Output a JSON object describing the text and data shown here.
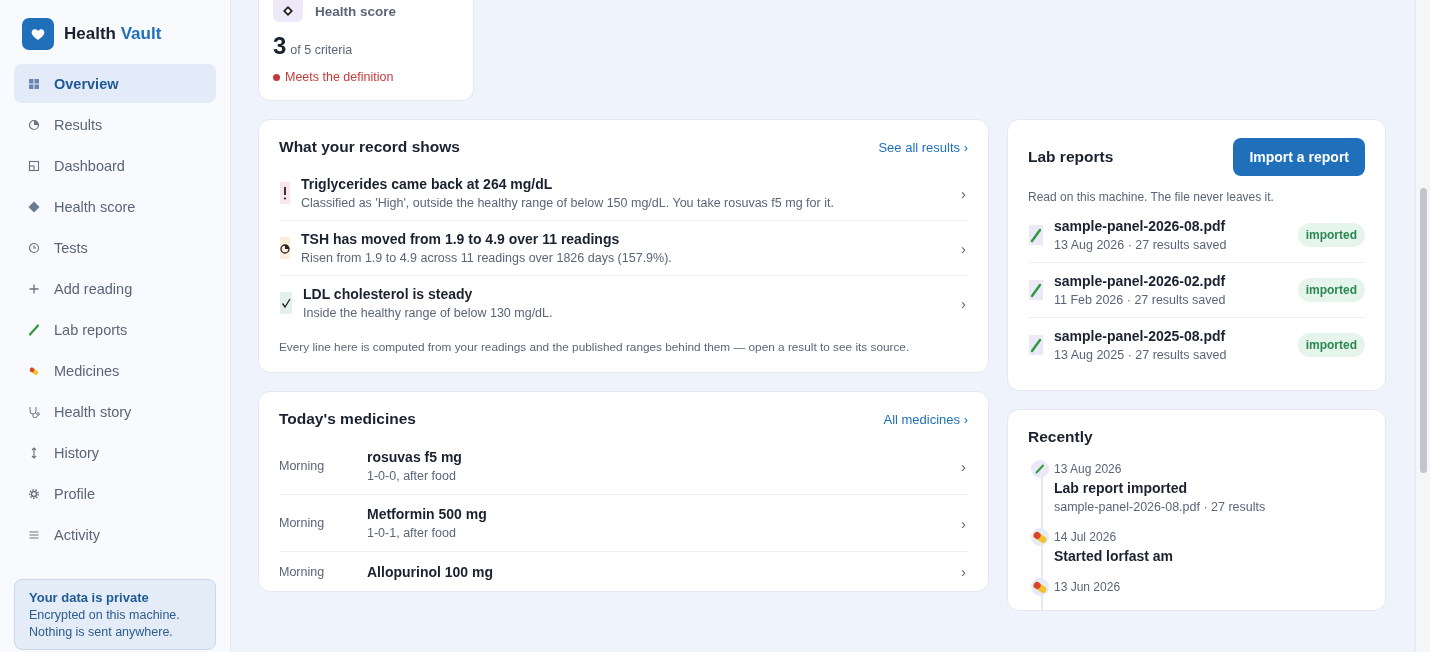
{
  "brand": {
    "name": "Health",
    "accent": "Vault"
  },
  "nav": [
    {
      "label": "Overview",
      "selected": true
    },
    {
      "label": "Results",
      "selected": false
    },
    {
      "label": "Dashboard",
      "selected": false
    },
    {
      "label": "Health score",
      "selected": false
    },
    {
      "label": "Tests",
      "selected": false
    },
    {
      "label": "Add reading",
      "selected": false
    },
    {
      "label": "Lab reports",
      "selected": false
    },
    {
      "label": "Medicines",
      "selected": false
    },
    {
      "label": "Health story",
      "selected": false
    },
    {
      "label": "History",
      "selected": false
    },
    {
      "label": "Profile",
      "selected": false
    },
    {
      "label": "Activity",
      "selected": false
    }
  ],
  "privacy": {
    "title": "Your data is private",
    "lines": [
      "Encrypted on this machine.",
      "Nothing is sent anywhere."
    ]
  },
  "score_card": {
    "title": "Health score",
    "value": "3",
    "of": "of 5 criteria",
    "status": "Meets the definition"
  },
  "record": {
    "title": "What your record shows",
    "link": "See all results ›",
    "items": [
      {
        "kind": "alert",
        "title": "Triglycerides came back at 264 mg/dL",
        "detail": "Classified as 'High', outside the healthy range of below 150 mg/dL. You take rosuvas f5 mg for it.",
        "chevron": "›"
      },
      {
        "kind": "trend",
        "title": "TSH has moved from 1.9 to 4.9 over 11 readings",
        "detail": "Risen from 1.9 to 4.9 across 11 readings over 1826 days (157.9%).",
        "chevron": "›"
      },
      {
        "kind": "ok",
        "title": "LDL cholesterol is steady",
        "detail": "Inside the healthy range of below 130 mg/dL.",
        "chevron": "›"
      }
    ],
    "footnote": "Every line here is computed from your readings and the published ranges behind them — open a result to see its source."
  },
  "medicines": {
    "title": "Today's medicines",
    "link": "All medicines ›",
    "items": [
      {
        "time": "Morning",
        "name": "rosuvas f5 mg",
        "dose": "1-0-0, after food",
        "chevron": "›"
      },
      {
        "time": "Morning",
        "name": "Metformin 500 mg",
        "dose": "1-0-1, after food",
        "chevron": "›"
      },
      {
        "time": "Morning",
        "name": "Allopurinol 100 mg",
        "chevron": "›"
      }
    ]
  },
  "lab_reports": {
    "title": "Lab reports",
    "button": "Import a report",
    "note": "Read on this machine. The file never leaves it.",
    "items": [
      {
        "file": "sample-panel-2026-08.pdf",
        "meta": "13 Aug 2026 · 27 results saved",
        "status": "imported"
      },
      {
        "file": "sample-panel-2026-02.pdf",
        "meta": "11 Feb 2026 · 27 results saved",
        "status": "imported"
      },
      {
        "file": "sample-panel-2025-08.pdf",
        "meta": "13 Aug 2025 · 27 results saved",
        "status": "imported"
      }
    ]
  },
  "recently": {
    "title": "Recently",
    "items": [
      {
        "kind": "lab",
        "date": "13 Aug 2026",
        "title": "Lab report imported",
        "detail": "sample-panel-2026-08.pdf · 27 results"
      },
      {
        "kind": "medicine",
        "date": "14 Jul 2026",
        "title": "Started lorfast am"
      },
      {
        "kind": "medicine",
        "date": "13 Jun 2026"
      }
    ]
  }
}
